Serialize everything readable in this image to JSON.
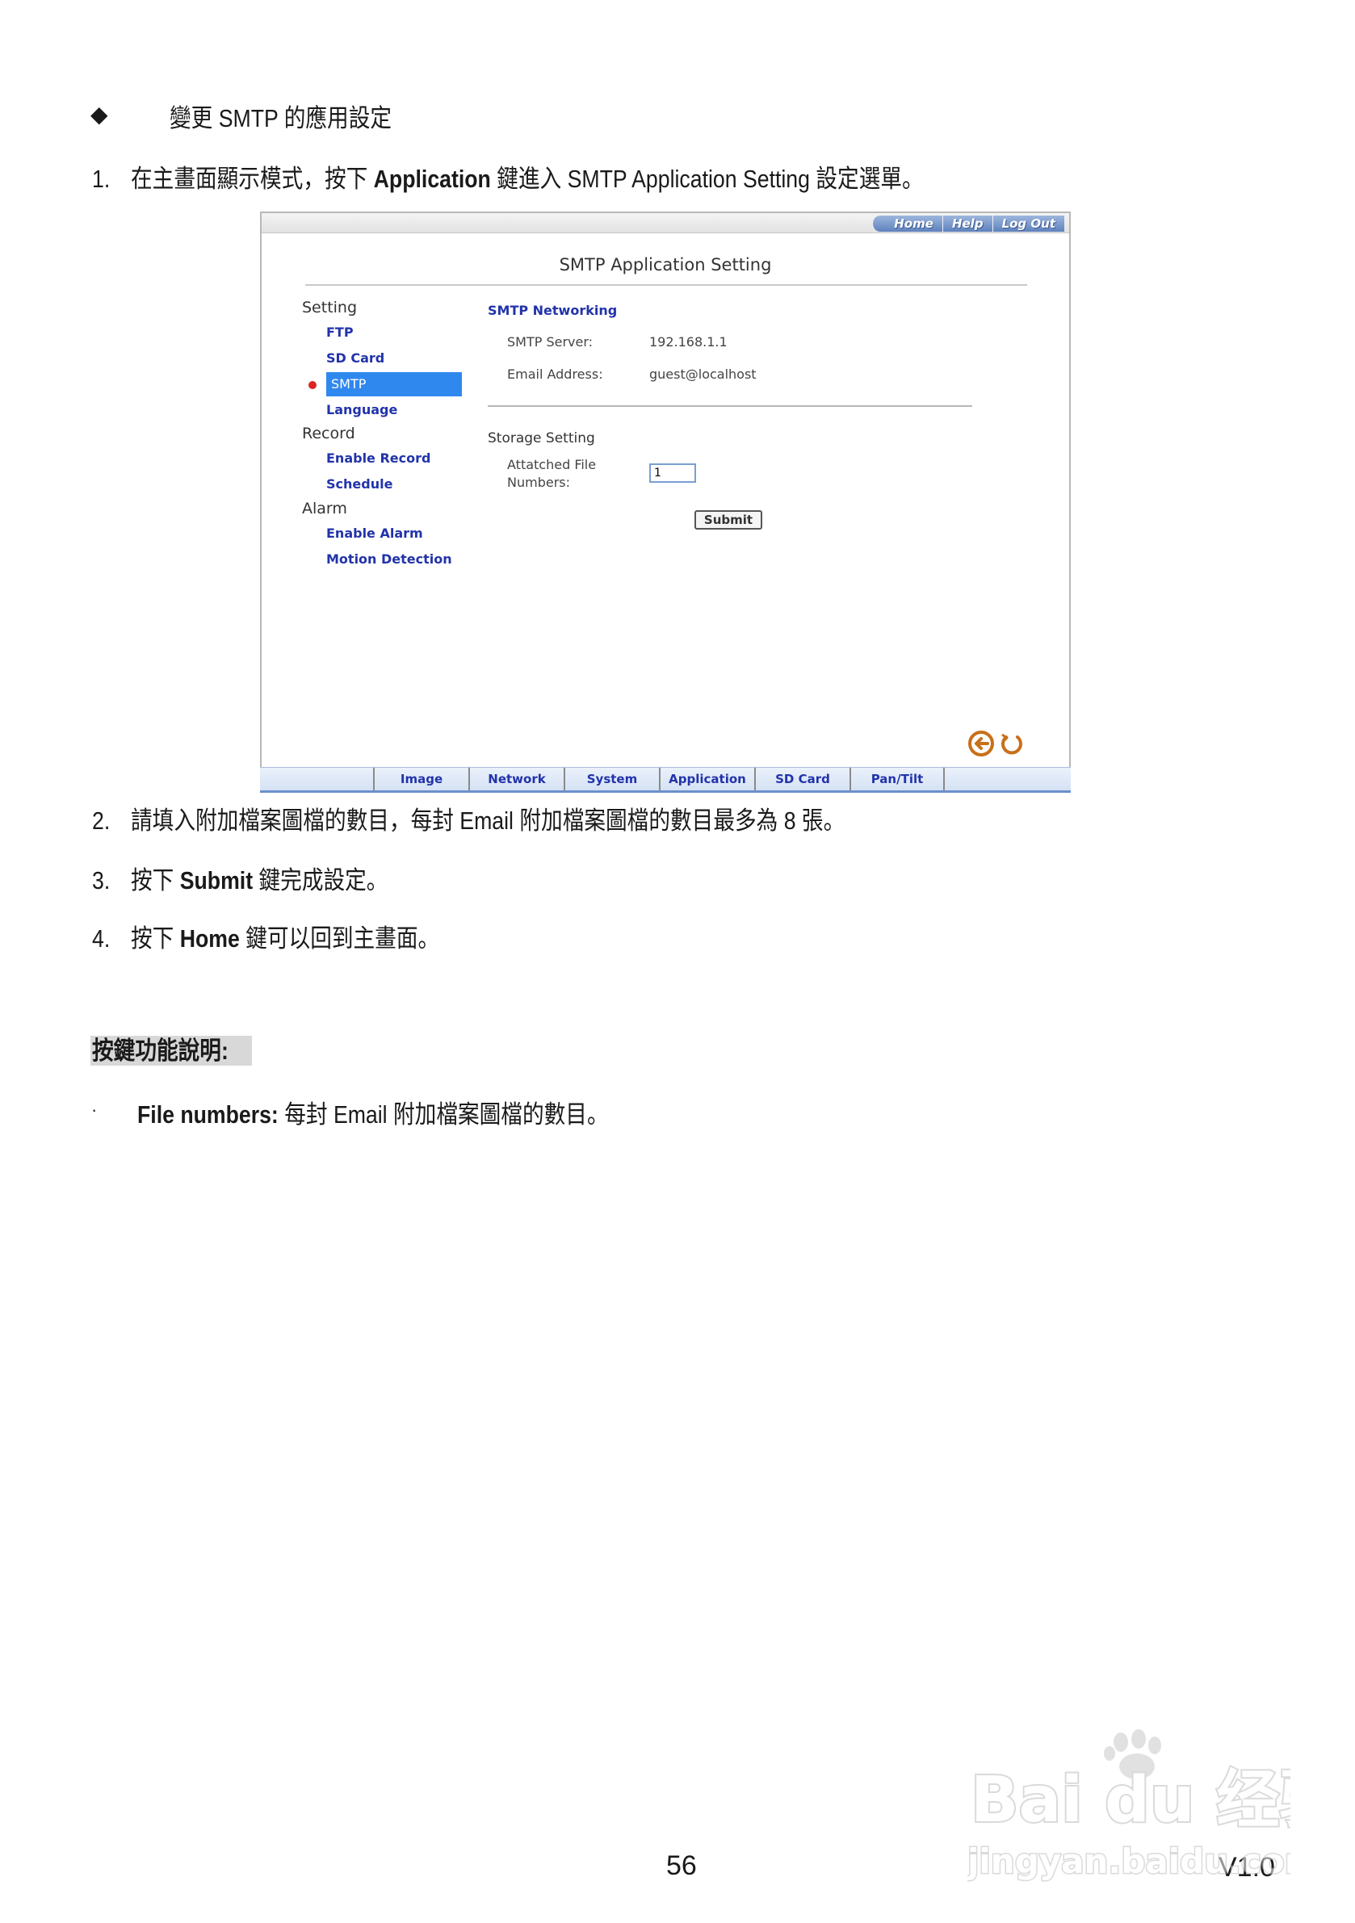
{
  "heading": {
    "bullet": "◆",
    "title": "變更 SMTP 的應用設定"
  },
  "steps": [
    {
      "num": "1.",
      "pre": "在主畫面顯示模式，按下 ",
      "bold": "Application",
      "post": "  鍵進入 SMTP Application Setting 設定選單。"
    },
    {
      "num": "2.",
      "text": "請填入附加檔案圖檔的數目，每封 Email 附加檔案圖檔的數目最多為 8 張。"
    },
    {
      "num": "3.",
      "pre": "按下 ",
      "bold": "Submit",
      "post": " 鍵完成設定。"
    },
    {
      "num": "4.",
      "pre": "按下 ",
      "bold": "Home",
      "post": " 鍵可以回到主畫面。"
    }
  ],
  "screenshot": {
    "top_nav": [
      "Home",
      "Help",
      "Log Out"
    ],
    "title": "SMTP Application Setting",
    "sidebar": {
      "setting_label": "Setting",
      "setting_items": [
        "FTP",
        "SD Card",
        "SMTP",
        "Language"
      ],
      "record_label": "Record",
      "record_items": [
        "Enable Record",
        "Schedule"
      ],
      "alarm_label": "Alarm",
      "alarm_items": [
        "Enable Alarm",
        "Motion Detection"
      ]
    },
    "smtp_networking": {
      "title": "SMTP Networking",
      "server_label": "SMTP Server:",
      "server_value": "192.168.1.1",
      "email_label": "Email Address:",
      "email_value": "guest@localhost"
    },
    "storage": {
      "title": "Storage Setting",
      "attach_label_1": "Attatched File",
      "attach_label_2": "Numbers:",
      "attach_value": "1",
      "submit_label": "Submit"
    },
    "icons": [
      "back-arrow-icon",
      "refresh-icon"
    ],
    "bottom_tabs": [
      "Image",
      "Network",
      "System",
      "Application",
      "SD Card",
      "Pan/Tilt"
    ],
    "colors": {
      "link": "#2233aa",
      "selected": "#2f88ee",
      "nav": "#5e81bd"
    }
  },
  "key_section": {
    "title": "按鍵功能說明:",
    "bullet": "·",
    "term": "File numbers:",
    "desc": "  每封 Email 附加檔案圖檔的數目。"
  },
  "footer": {
    "page_number": "56",
    "version": "V1.0",
    "watermark_text": "Bai du 经验",
    "watermark_url": "jingyan.baidu.com"
  }
}
